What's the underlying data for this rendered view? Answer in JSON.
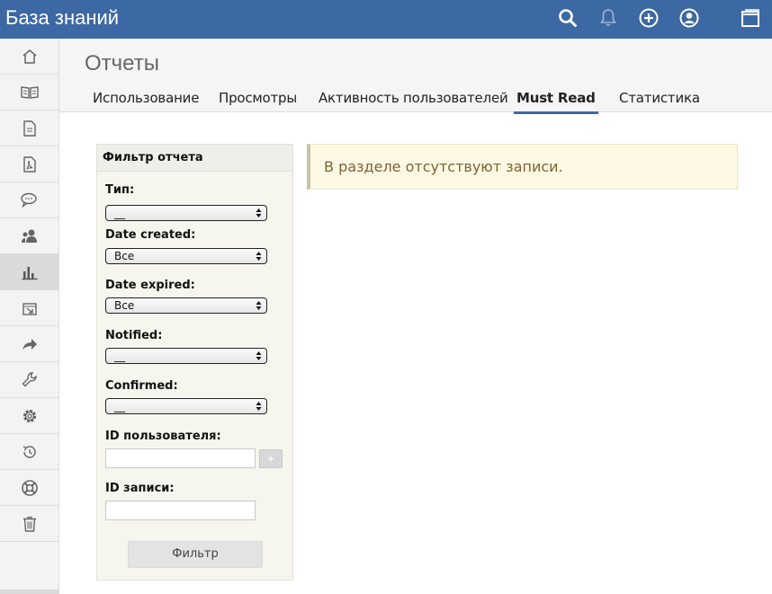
{
  "header": {
    "title": "База знаний",
    "icons": [
      "search-icon",
      "bell-icon",
      "plus-circle-icon",
      "user-icon",
      "window-icon"
    ]
  },
  "sidebar": {
    "items": [
      {
        "icon": "home-icon"
      },
      {
        "icon": "book-icon"
      },
      {
        "icon": "document-icon"
      },
      {
        "icon": "pdf-document-icon"
      },
      {
        "icon": "chat-icon"
      },
      {
        "icon": "users-icon"
      },
      {
        "icon": "bar-chart-icon",
        "active": true
      },
      {
        "icon": "import-icon"
      },
      {
        "icon": "share-arrow-icon"
      },
      {
        "icon": "wrench-icon"
      },
      {
        "icon": "gear-icon"
      },
      {
        "icon": "history-icon"
      },
      {
        "icon": "lifebuoy-icon"
      },
      {
        "icon": "trash-icon"
      }
    ]
  },
  "page": {
    "title": "Отчеты",
    "tabs": [
      {
        "label": "Использование"
      },
      {
        "label": "Просмотры"
      },
      {
        "label": "Активность пользователей"
      },
      {
        "label": "Must Read",
        "active": true
      },
      {
        "label": "Статистика"
      }
    ]
  },
  "filter": {
    "title": "Фильтр отчета",
    "type_label": "Тип:",
    "type_value": "__",
    "date_created_label": "Date created:",
    "date_created_value": "Все",
    "date_expired_label": "Date expired:",
    "date_expired_value": "Все",
    "notified_label": "Notified:",
    "notified_value": "__",
    "confirmed_label": "Confirmed:",
    "confirmed_value": "__",
    "user_id_label": "ID пользователя:",
    "user_id_value": "",
    "add_label": "+",
    "entry_id_label": "ID записи:",
    "entry_id_value": "",
    "submit_label": "Фильтр"
  },
  "notice": {
    "text": "В разделе отсутствуют записи."
  },
  "colors": {
    "header_bg": "#3c69a4",
    "active_tab_underline": "#3c69a4",
    "notice_bg": "#fcf8e3",
    "notice_text": "#7a6432"
  }
}
